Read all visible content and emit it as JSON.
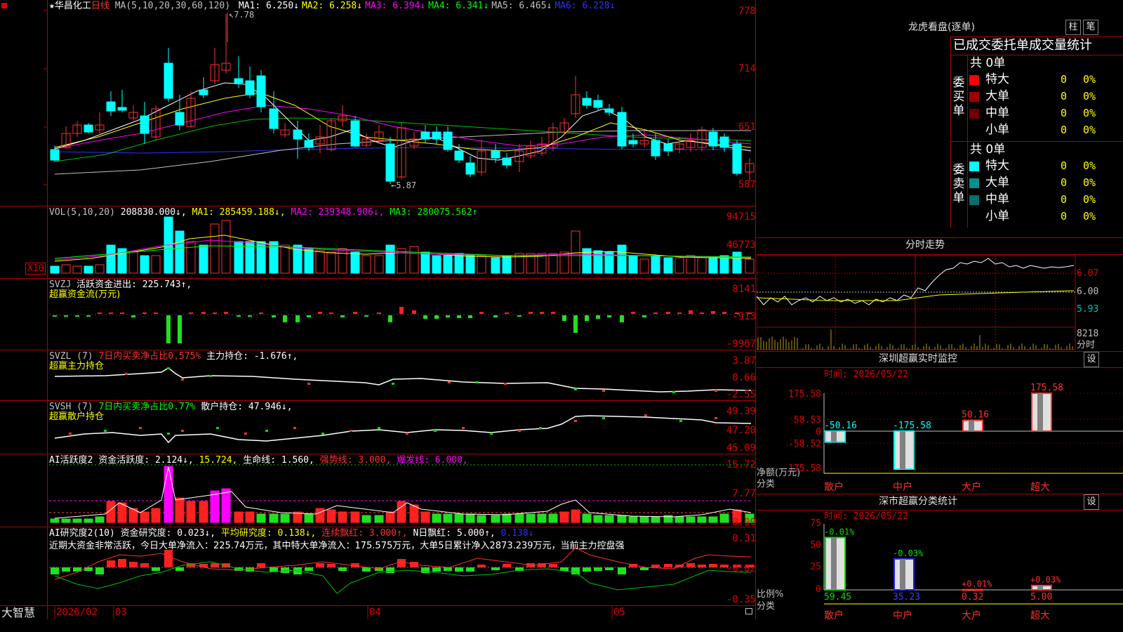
{
  "app": {
    "brand": "大智慧"
  },
  "main_chart": {
    "stock_name": "华昌化工",
    "period": "日线",
    "ma_header": "MA(5,10,20,30,60,120)",
    "ma_values": [
      {
        "label": "MA1:",
        "value": "6.250↓",
        "color": "#ffffff"
      },
      {
        "label": "MA2:",
        "value": "6.258↓",
        "color": "#ffff00"
      },
      {
        "label": "MA3:",
        "value": "6.394↓",
        "color": "#ff00ff"
      },
      {
        "label": "MA4:",
        "value": "6.341↓",
        "color": "#00ff00"
      },
      {
        "label": "MA5:",
        "value": "6.465↓",
        "color": "#c0c0c0"
      },
      {
        "label": "MA6:",
        "value": "6.228↓",
        "color": "#3030ff"
      }
    ],
    "high_marker": "7.78",
    "low_marker": "5.87",
    "y_ticks": [
      "778",
      "714",
      "651",
      "587"
    ]
  },
  "vol_panel": {
    "header": "VOL(5,10,20)",
    "vol": "208830.000↓,",
    "ma1": "MA1: 285459.188↓,",
    "ma2": "MA2: 239348.906↓,",
    "ma3": "MA3: 280075.562↑",
    "y_ticks": [
      "94715",
      "46773"
    ],
    "unit": "X10"
  },
  "svzj_panel": {
    "header": "SVZJ",
    "label": "活跃资金进出: 225.743↑,",
    "subtitle": "超赢资金流(万元)",
    "y_ticks": [
      "8141",
      "-913",
      "-9967"
    ]
  },
  "svzl_panel": {
    "header": "SVZL (7)",
    "ratio": "7日内买卖净占比0.575%",
    "label": "主力持仓: -1.676↑,",
    "subtitle": "超赢主力持仓",
    "y_ticks": [
      "3.87",
      "0.66",
      "-2.55"
    ]
  },
  "svsh_panel": {
    "header": "SVSH (7)",
    "ratio": "7日内买卖净占比0.77%",
    "label": "散户持仓: 47.946↓,",
    "subtitle": "超赢散户持仓",
    "y_ticks": [
      "49.39",
      "47.20",
      "45.09"
    ]
  },
  "ai_active_panel": {
    "header": "AI活跃度2",
    "label1": "资金活跃度: 2.124↓,",
    "value2": "15.724,",
    "label3": "生命线: 1.560,",
    "label4": "强势线: 3.000,",
    "label5": "爆发线: 6.000,",
    "y_ticks": [
      "15.72",
      "7.77",
      "0.00"
    ]
  },
  "ai_research_panel": {
    "header": "AI研究度2(10)",
    "label1": "资金研究度: 0.023↓,",
    "label2": "平均研究度: 0.138↓,",
    "label3": "连续飘红: 3.000↑,",
    "label4": "N日飘红: 5.000↑,",
    "label5": "0.138↓",
    "summary": "近期大资金非常活跃，今日大单净流入：225.74万元，其中特大单净流入：175.575万元，大单5日累计净入2873.239万元，当前主力控盘强",
    "y_ticks": [
      "0.31",
      "-0.02",
      "-0.35"
    ]
  },
  "x_axis": {
    "labels": [
      "2026/02",
      "03",
      "04",
      "05"
    ]
  },
  "right_panel": {
    "title": "龙虎看盘(逐单)",
    "btn_bar": "柱",
    "btn_pen": "笔",
    "order_stats_title": "已成交委托单成交量统计",
    "buy_side": {
      "vertical_label": "委买单",
      "total": "共 0单",
      "rows": [
        {
          "label": "特大",
          "count": "0",
          "pct": "0%",
          "color": "#ff0000"
        },
        {
          "label": "大单",
          "count": "0",
          "pct": "0%",
          "color": "#a00000"
        },
        {
          "label": "中单",
          "count": "0",
          "pct": "0%",
          "color": "#700000"
        },
        {
          "label": "小单",
          "count": "0",
          "pct": "0%",
          "color": ""
        }
      ]
    },
    "sell_side": {
      "vertical_label": "委卖单",
      "total": "共 0单",
      "rows": [
        {
          "label": "特大",
          "count": "0",
          "pct": "0%",
          "color": "#00ffff"
        },
        {
          "label": "大单",
          "count": "0",
          "pct": "0%",
          "color": "#009090"
        },
        {
          "label": "中单",
          "count": "0",
          "pct": "0%",
          "color": "#007070"
        },
        {
          "label": "小单",
          "count": "0",
          "pct": "0%",
          "color": ""
        }
      ]
    },
    "intraday": {
      "title": "分时走势",
      "price_ticks": [
        "6.07",
        "6.00",
        "5.93"
      ],
      "vol_tick": "8218",
      "vol_unit": "分时"
    },
    "sz_monitor": {
      "title": "深圳超赢实时监控",
      "settings": "设",
      "time_label": "时间: 2026/05/22",
      "y_ticks": [
        "175.58",
        "58.53",
        "0",
        "-58.52",
        "-175.58"
      ],
      "y_label": "净额(万元)",
      "x_label": "分类",
      "categories": [
        "散户",
        "中户",
        "大户",
        "超大"
      ],
      "values": [
        -50.16,
        -175.58,
        50.16,
        175.58
      ],
      "value_labels": [
        "-50.16",
        "-175.58",
        "50.16",
        "175.58"
      ]
    },
    "sz_classify": {
      "title": "深市超赢分类统计",
      "settings": "设",
      "time_label": "时间: 2026/05/22",
      "y_ticks": [
        "75",
        "50",
        "25",
        "0"
      ],
      "y_label": "比例%",
      "x_label": "分类",
      "categories": [
        "散户",
        "中户",
        "大户",
        "超大"
      ],
      "values": [
        59.45,
        35.23,
        0.32,
        5.0
      ],
      "value_labels": [
        "59.45",
        "35.23",
        "0.32",
        "5.00"
      ],
      "change_labels": [
        "-0.01%",
        "-0.03%",
        "+0.01%",
        "+0.03%"
      ]
    }
  }
}
